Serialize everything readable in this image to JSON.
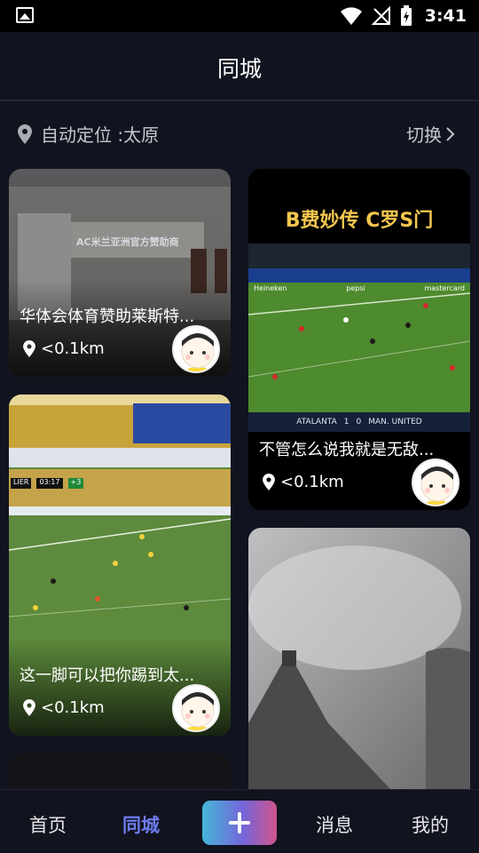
{
  "status_bar": {
    "time": "3:41"
  },
  "header": {
    "title": "同城"
  },
  "location": {
    "label": "自动定位 :太原",
    "switch_label": "切换"
  },
  "cards": [
    {
      "title": "华体会体育赞助莱斯特...",
      "distance": "<0.1km",
      "overlay_text": "AC米兰亚洲官方赞助商"
    },
    {
      "title": "不管怎么说我就是无敌...",
      "distance": "<0.1km",
      "video_caption": "B费妙传 C罗S门",
      "ad_brands": [
        "Heineken",
        "pepsi",
        "mastercard"
      ],
      "scoreboard": {
        "home": "ATALANTA",
        "home_score": "1",
        "away_score": "0",
        "away": "MAN. UNITED"
      }
    },
    {
      "title": "这一脚可以把你踢到太...",
      "distance": "<0.1km",
      "score_overlay": {
        "team": "LIER",
        "time": "03:17",
        "extra": "+3"
      }
    }
  ],
  "bottom_nav": {
    "items": [
      "首页",
      "同城",
      "消息",
      "我的"
    ],
    "active": "同城"
  },
  "colors": {
    "background": "#11131f",
    "accent": "#6e7cf0",
    "text_muted": "#c4c6d0"
  }
}
